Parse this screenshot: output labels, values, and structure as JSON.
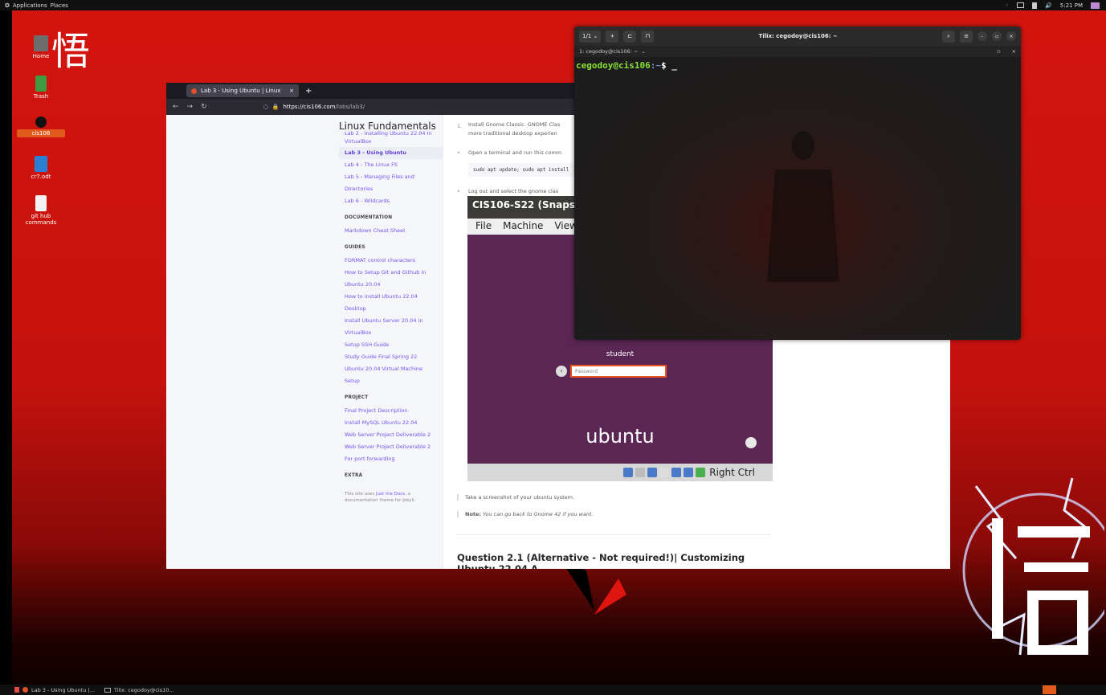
{
  "top_panel": {
    "applications": "Applications",
    "places": "Places",
    "time": "5:21 PM"
  },
  "desktop": {
    "kanji": "悟",
    "icons": [
      {
        "label": "Home",
        "icon": "home-folder-icon"
      },
      {
        "label": "Trash",
        "icon": "trash-icon"
      },
      {
        "label": "cis106",
        "icon": "folder-icon",
        "selected": true
      },
      {
        "label": "cr7.odt",
        "icon": "document-icon"
      },
      {
        "label": "git hub commands",
        "icon": "text-file-icon"
      }
    ]
  },
  "browser": {
    "tab_title": "Lab 3 - Using Ubuntu | Linux",
    "url_domain": "https://cis106.com",
    "url_path": "/labs/lab3/",
    "site_title": "Linux Fundamentals",
    "nav_top": [
      "Lab 2 - Installing Ubuntu 22.04 In VirtualBox",
      "Lab 3 - Using Ubuntu",
      "Lab 4 - The Linux FS",
      "Lab 5 - Managing Files and Directories",
      "Lab 6 - Wildcards"
    ],
    "documentation_title": "DOCUMENTATION",
    "documentation_items": [
      "Markdown Cheat Sheet"
    ],
    "guides_title": "GUIDES",
    "guides_items": [
      "FORMAT control characters",
      "How to Setup Git and Github in Ubuntu 20.04",
      "How to install Ubuntu 22.04 Desktop",
      "Install Ubuntu Server 20.04 in VirtualBox",
      "Setup SSH Guide",
      "Study Guide Final Spring 22",
      "Ubuntu 20.04 Virtual Machine Setup"
    ],
    "project_title": "PROJECT",
    "project_items": [
      "Final Project Description",
      "Install MySQL Ubuntu 22.04",
      "Web Server Project Deliverable 2",
      "Web Server Project Deliverable 2 For port forwarding"
    ],
    "extra_title": "EXTRA",
    "footer_pre": "This site uses ",
    "footer_link": "Just the Docs",
    "footer_post": ", a documentation theme for Jekyll.",
    "content": {
      "item1_num": "1.",
      "item1_line1": "Install Gnome Classic. GNOME Clas",
      "item1_line2": "more traditional desktop experien",
      "bullet2": "Open a terminal and run this comm",
      "code": "sudo apt update; sudo apt install",
      "bullet3": "Log out and select the gnome clas",
      "vm_title": "CIS106-S22 (Snapshot 1",
      "vm_menu": [
        "File",
        "Machine",
        "View"
      ],
      "vm_user": "student",
      "vm_password_placeholder": "Password",
      "vm_logo": "ubuntu",
      "vm_host_key": "Right Ctrl",
      "quote1": "Take a screenshot of your ubuntu system.",
      "note_label": "Note:",
      "note_text": " You can go back to Gnome 42 if you want.",
      "heading": "Question 2.1 (Alternative - Not required!)| Customizing Ubuntu 22.04 A..."
    }
  },
  "terminal": {
    "title": "Tilix: cegodoy@cis106: ~",
    "session": "1/1",
    "subtitle": "1: cegodoy@cis106: ~",
    "prompt_user": "cegodoy@cis106",
    "prompt_path": ":~",
    "prompt_symbol": "$ _"
  },
  "bottom_panel": {
    "item1": "Lab 3 - Using Ubuntu |...",
    "item2": "Tilix: cegodoy@cis10..."
  },
  "colors": {
    "accent": "#e25a1c",
    "link": "#7253ed",
    "ubuntu_purple": "#5a2654"
  }
}
